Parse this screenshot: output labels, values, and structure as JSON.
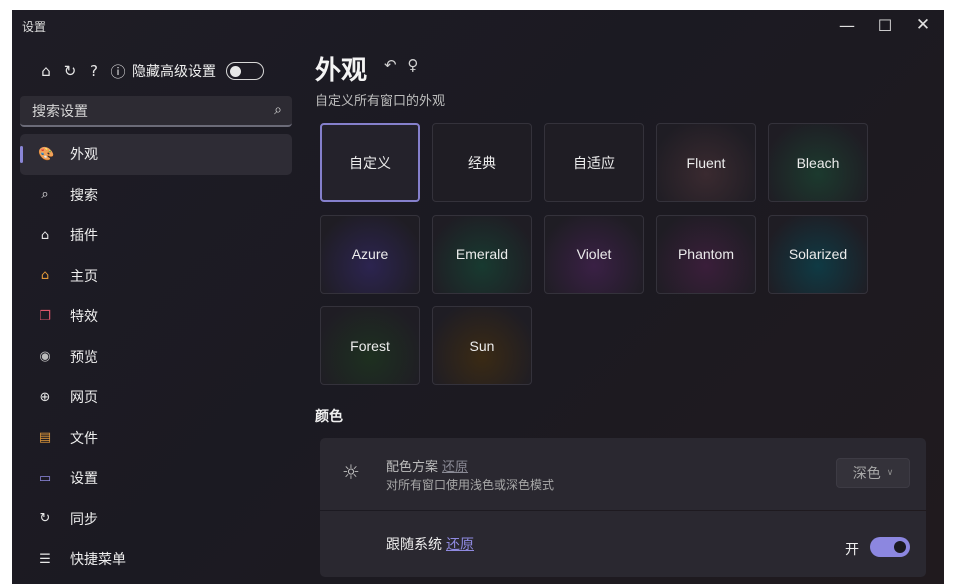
{
  "window": {
    "title": "设置"
  },
  "sidebar": {
    "hide_advanced_label": "隐藏高级设置",
    "search_placeholder": "搜索设置",
    "items": [
      {
        "label": "外观",
        "icon": "palette-icon",
        "icon_glyph": "🎨",
        "color": "#e0566a",
        "active": true
      },
      {
        "label": "搜索",
        "icon": "search-icon",
        "icon_glyph": "⌕",
        "color": "#e8e8e8"
      },
      {
        "label": "插件",
        "icon": "plugin-icon",
        "icon_glyph": "⌂",
        "color": "#e8e8e8"
      },
      {
        "label": "主页",
        "icon": "home-icon",
        "icon_glyph": "⌂",
        "color": "#e39a3a"
      },
      {
        "label": "特效",
        "icon": "effects-icon",
        "icon_glyph": "❐",
        "color": "#e0566a"
      },
      {
        "label": "预览",
        "icon": "eye-icon",
        "icon_glyph": "◉",
        "color": "#bcbcbc"
      },
      {
        "label": "网页",
        "icon": "globe-icon",
        "icon_glyph": "⊕",
        "color": "#e8e8e8"
      },
      {
        "label": "文件",
        "icon": "file-icon",
        "icon_glyph": "▤",
        "color": "#e39a3a"
      },
      {
        "label": "设置",
        "icon": "laptop-icon",
        "icon_glyph": "▭",
        "color": "#8f8ae0"
      },
      {
        "label": "同步",
        "icon": "sync-icon",
        "icon_glyph": "↻",
        "color": "#e8e8e8"
      },
      {
        "label": "快捷菜单",
        "icon": "menu-icon",
        "icon_glyph": "☰",
        "color": "#e8e8e8"
      }
    ]
  },
  "main": {
    "title": "外观",
    "subtitle": "自定义所有窗口的外观",
    "themes": [
      {
        "label": "自定义",
        "selected": true,
        "glow": ""
      },
      {
        "label": "经典",
        "glow": ""
      },
      {
        "label": "自适应",
        "glow": ""
      },
      {
        "label": "Fluent",
        "glow": "#3a2a30"
      },
      {
        "label": "Bleach",
        "glow": "#1c3a2e"
      },
      {
        "label": "Azure",
        "glow": "#2c2450"
      },
      {
        "label": "Emerald",
        "glow": "#183a30"
      },
      {
        "label": "Violet",
        "glow": "#3a2045"
      },
      {
        "label": "Phantom",
        "glow": "#3a1e3a"
      },
      {
        "label": "Solarized",
        "glow": "#0f3a44"
      },
      {
        "label": "Forest",
        "glow": "#1e3020"
      },
      {
        "label": "Sun",
        "glow": "#3a2a14"
      }
    ],
    "color_section": "颜色",
    "color_scheme": {
      "title": "配色方案",
      "restore": "还原",
      "description": "对所有窗口使用浅色或深色模式",
      "value": "深色"
    },
    "follow_system": {
      "title": "跟随系统",
      "restore": "还原",
      "state_label": "开"
    }
  }
}
